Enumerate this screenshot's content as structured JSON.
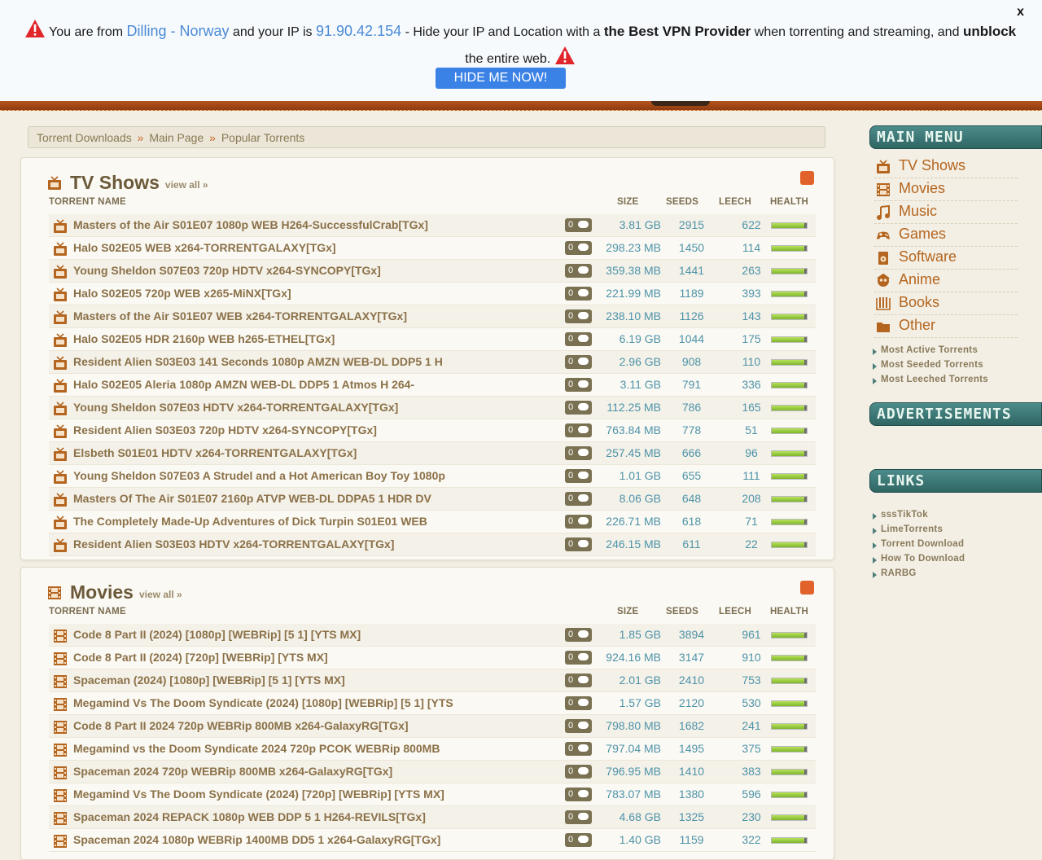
{
  "vpn_banner": {
    "text_1": "You are from",
    "location": "Dilling - Norway",
    "text_2": "and your IP is",
    "ip": "91.90.42.154",
    "text_3": "- Hide your IP and Location with a",
    "bold_1": "the Best VPN Provider",
    "text_4": "when torrenting and streaming, and",
    "bold_2": "unblock",
    "text_5": "the entire web.",
    "button": "HIDE ME NOW!",
    "close": "x"
  },
  "breadcrumb": {
    "items": [
      "Torrent Downloads",
      "Main Page",
      "Popular Torrents"
    ],
    "separator": "»"
  },
  "columns": {
    "name": "TORRENT NAME",
    "size": "SIZE",
    "seeds": "SEEDS",
    "leech": "LEECH",
    "health": "HEALTH"
  },
  "tv": {
    "title": "TV Shows",
    "view_all": "view all »",
    "rows": [
      {
        "name": "Masters of the Air S01E07 1080p WEB H264-SuccessfulCrab[TGx]",
        "comments": "0",
        "size": "3.81 GB",
        "seeds": "2915",
        "leech": "622",
        "health": 0.92
      },
      {
        "name": "Halo S02E05 WEB x264-TORRENTGALAXY[TGx]",
        "comments": "0",
        "size": "298.23 MB",
        "seeds": "1450",
        "leech": "114",
        "health": 0.92
      },
      {
        "name": "Young Sheldon S07E03 720p HDTV x264-SYNCOPY[TGx]",
        "comments": "0",
        "size": "359.38 MB",
        "seeds": "1441",
        "leech": "263",
        "health": 0.92
      },
      {
        "name": "Halo S02E05 720p WEB x265-MiNX[TGx]",
        "comments": "0",
        "size": "221.99 MB",
        "seeds": "1189",
        "leech": "393",
        "health": 0.92
      },
      {
        "name": "Masters of the Air S01E07 WEB x264-TORRENTGALAXY[TGx]",
        "comments": "0",
        "size": "238.10 MB",
        "seeds": "1126",
        "leech": "143",
        "health": 0.92
      },
      {
        "name": "Halo S02E05 HDR 2160p WEB h265-ETHEL[TGx]",
        "comments": "0",
        "size": "6.19 GB",
        "seeds": "1044",
        "leech": "175",
        "health": 0.92
      },
      {
        "name": "Resident Alien S03E03 141 Seconds 1080p AMZN WEB-DL DDP5 1 H",
        "comments": "0",
        "size": "2.96 GB",
        "seeds": "908",
        "leech": "110",
        "health": 0.92
      },
      {
        "name": "Halo S02E05 Aleria 1080p AMZN WEB-DL DDP5 1 Atmos H 264-",
        "comments": "0",
        "size": "3.11 GB",
        "seeds": "791",
        "leech": "336",
        "health": 0.92
      },
      {
        "name": "Young Sheldon S07E03 HDTV x264-TORRENTGALAXY[TGx]",
        "comments": "0",
        "size": "112.25 MB",
        "seeds": "786",
        "leech": "165",
        "health": 0.92
      },
      {
        "name": "Resident Alien S03E03 720p HDTV x264-SYNCOPY[TGx]",
        "comments": "0",
        "size": "763.84 MB",
        "seeds": "778",
        "leech": "51",
        "health": 0.92
      },
      {
        "name": "Elsbeth S01E01 HDTV x264-TORRENTGALAXY[TGx]",
        "comments": "0",
        "size": "257.45 MB",
        "seeds": "666",
        "leech": "96",
        "health": 0.92
      },
      {
        "name": "Young Sheldon S07E03 A Strudel and a Hot American Boy Toy 1080p",
        "comments": "0",
        "size": "1.01 GB",
        "seeds": "655",
        "leech": "111",
        "health": 0.92
      },
      {
        "name": "Masters Of The Air S01E07 2160p ATVP WEB-DL DDPA5 1 HDR DV",
        "comments": "0",
        "size": "8.06 GB",
        "seeds": "648",
        "leech": "208",
        "health": 0.92
      },
      {
        "name": "The Completely Made-Up Adventures of Dick Turpin S01E01 WEB",
        "comments": "0",
        "size": "226.71 MB",
        "seeds": "618",
        "leech": "71",
        "health": 0.92
      },
      {
        "name": "Resident Alien S03E03 HDTV x264-TORRENTGALAXY[TGx]",
        "comments": "0",
        "size": "246.15 MB",
        "seeds": "611",
        "leech": "22",
        "health": 0.92
      }
    ]
  },
  "movies": {
    "title": "Movies",
    "view_all": "view all »",
    "rows": [
      {
        "name": "Code 8 Part II (2024) [1080p] [WEBRip] [5 1] [YTS MX]",
        "comments": "0",
        "size": "1.85 GB",
        "seeds": "3894",
        "leech": "961",
        "health": 0.92
      },
      {
        "name": "Code 8 Part II (2024) [720p] [WEBRip] [YTS MX]",
        "comments": "0",
        "size": "924.16 MB",
        "seeds": "3147",
        "leech": "910",
        "health": 0.92
      },
      {
        "name": "Spaceman (2024) [1080p] [WEBRip] [5 1] [YTS MX]",
        "comments": "0",
        "size": "2.01 GB",
        "seeds": "2410",
        "leech": "753",
        "health": 0.92
      },
      {
        "name": "Megamind Vs The Doom Syndicate (2024) [1080p] [WEBRip] [5 1] [YTS",
        "comments": "0",
        "size": "1.57 GB",
        "seeds": "2120",
        "leech": "530",
        "health": 0.92
      },
      {
        "name": "Code 8 Part II 2024 720p WEBRip 800MB x264-GalaxyRG[TGx]",
        "comments": "0",
        "size": "798.80 MB",
        "seeds": "1682",
        "leech": "241",
        "health": 0.92
      },
      {
        "name": "Megamind vs the Doom Syndicate 2024 720p PCOK WEBRip 800MB",
        "comments": "0",
        "size": "797.04 MB",
        "seeds": "1495",
        "leech": "375",
        "health": 0.92
      },
      {
        "name": "Spaceman 2024 720p WEBRip 800MB x264-GalaxyRG[TGx]",
        "comments": "0",
        "size": "796.95 MB",
        "seeds": "1410",
        "leech": "383",
        "health": 0.92
      },
      {
        "name": "Megamind Vs The Doom Syndicate (2024) [720p] [WEBRip] [YTS MX]",
        "comments": "0",
        "size": "783.07 MB",
        "seeds": "1380",
        "leech": "596",
        "health": 0.92
      },
      {
        "name": "Spaceman 2024 REPACK 1080p WEB DDP 5 1 H264-REVILS[TGx]",
        "comments": "0",
        "size": "4.68 GB",
        "seeds": "1325",
        "leech": "230",
        "health": 0.92
      },
      {
        "name": "Spaceman 2024 1080p WEBRip 1400MB DD5 1 x264-GalaxyRG[TGx]",
        "comments": "0",
        "size": "1.40 GB",
        "seeds": "1159",
        "leech": "322",
        "health": 0.92
      }
    ]
  },
  "sidebar": {
    "main_menu_title": "MAIN MENU",
    "menu": [
      {
        "label": "TV Shows",
        "icon": "tv-icon"
      },
      {
        "label": "Movies",
        "icon": "film-icon"
      },
      {
        "label": "Music",
        "icon": "music-note-icon"
      },
      {
        "label": "Games",
        "icon": "gamepad-icon"
      },
      {
        "label": "Software",
        "icon": "software-icon"
      },
      {
        "label": "Anime",
        "icon": "anime-icon"
      },
      {
        "label": "Books",
        "icon": "book-icon"
      },
      {
        "label": "Other",
        "icon": "folder-icon"
      }
    ],
    "stats_links": [
      "Most Active Torrents",
      "Most Seeded Torrents",
      "Most Leeched Torrents"
    ],
    "ads_title": "ADVERTISEMENTS",
    "links_title": "LINKS",
    "links": [
      "sssTikTok",
      "LimeTorrents",
      "Torrent Download",
      "How To Download",
      "RARBG"
    ]
  },
  "colors": {
    "accent_orange": "#b4651f",
    "teal_header": "#3b7a78",
    "link_blue": "#4d93a8",
    "vpn_button": "#3b82e6"
  }
}
